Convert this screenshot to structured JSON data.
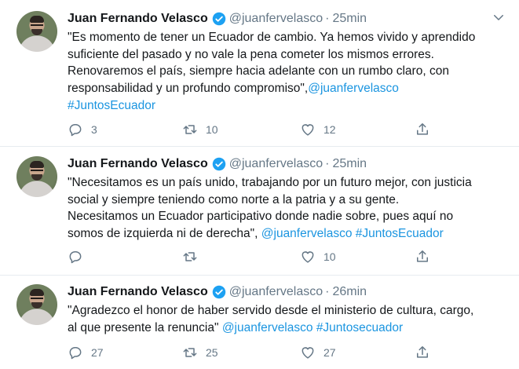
{
  "colors": {
    "link": "#1b95e0",
    "muted": "#657786",
    "text": "#14171a",
    "verified": "#1da1f2"
  },
  "tweets": [
    {
      "name": "Juan Fernando Velasco",
      "handle": "@juanfervelasco",
      "separator": "·",
      "time": "25min",
      "lines": [
        "\"Es momento de tener un Ecuador de cambio. Ya hemos vivido y aprendido",
        "suficiente del pasado y no vale la pena cometer los mismos errores.",
        "Renovaremos el país, siempre hacia adelante con un rumbo claro, con"
      ],
      "last_line_text": "responsabilidad y un profundo compromiso\",",
      "mention": "@juanfervelasco",
      "hashtag": "#JuntosEcuador",
      "replies": "3",
      "retweets": "10",
      "likes": "12"
    },
    {
      "name": "Juan Fernando Velasco",
      "handle": "@juanfervelasco",
      "separator": "·",
      "time": "25min",
      "lines": [
        "\"Necesitamos es un país unido, trabajando por un futuro mejor, con justicia",
        "social y siempre teniendo como norte a la patria y a su gente.",
        "Necesitamos un Ecuador participativo donde nadie sobre, pues aquí no"
      ],
      "last_line_text": "somos de izquierda ni de derecha\", ",
      "mention": "@juanfervelasco",
      "hashtag": "#JuntosEcuador",
      "replies": "",
      "retweets": "",
      "likes": "10"
    },
    {
      "name": "Juan Fernando Velasco",
      "handle": "@juanfervelasco",
      "separator": "·",
      "time": "26min",
      "lines": [
        "\"Agradezco el honor de haber servido desde el ministerio de cultura, cargo,"
      ],
      "last_line_text": "al que presente la renuncia\" ",
      "mention": "@juanfervelasco",
      "hashtag": "#Juntosecuador",
      "replies": "27",
      "retweets": "25",
      "likes": "27"
    }
  ]
}
